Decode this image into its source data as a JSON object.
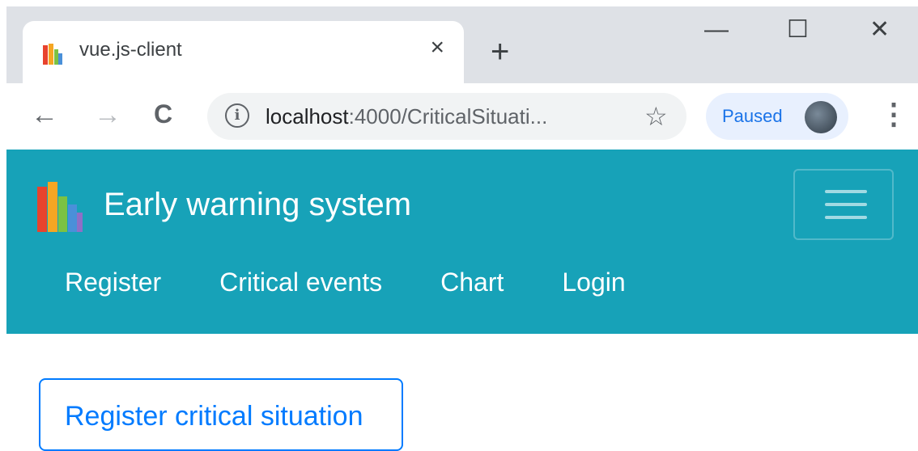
{
  "browser": {
    "tab": {
      "title": "vue.js-client",
      "close_glyph": "×",
      "favicon": "books-icon"
    },
    "new_tab_glyph": "+",
    "window_controls": {
      "minimize": "—",
      "maximize": "☐",
      "close": "✕"
    },
    "nav": {
      "back": "←",
      "forward": "→",
      "reload": "C"
    },
    "address": {
      "host": "localhost",
      "rest": ":4000/CriticalSituati...",
      "info_glyph": "i"
    },
    "bookmark_glyph": "☆",
    "profile": {
      "status": "Paused"
    },
    "menu_glyph": "⋮"
  },
  "app": {
    "brand": "Early warning system",
    "nav_items": [
      "Register",
      "Critical events",
      "Chart",
      "Login"
    ],
    "colors": {
      "navbar": "#17a2b8",
      "primary": "#007bff"
    }
  },
  "content": {
    "register_button": "Register critical situation"
  }
}
